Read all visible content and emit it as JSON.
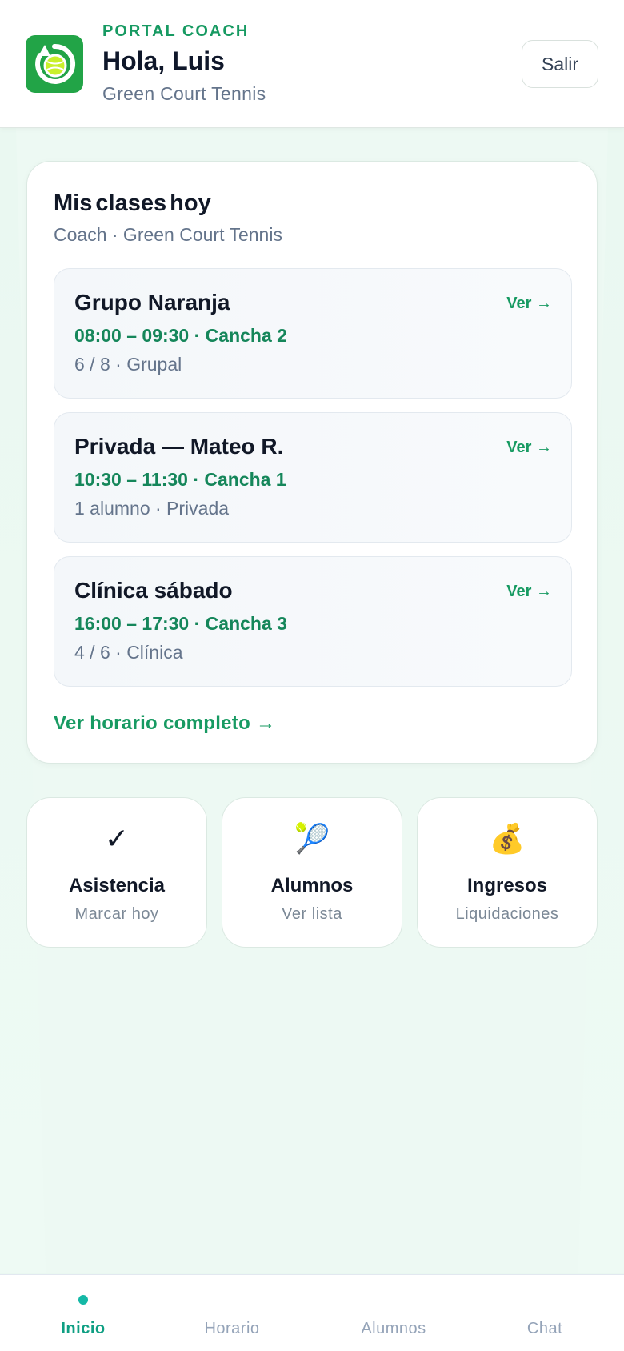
{
  "header": {
    "eyebrow": "PORTAL COACH",
    "greeting": "Hola, Luis",
    "club": "Green Court Tennis",
    "logout_label": "Salir",
    "logo_icon": "tennis-ball-refresh-icon"
  },
  "today": {
    "title": "Mis clases hoy",
    "subtitle": "Coach · Green Court Tennis",
    "classes": [
      {
        "name": "Grupo Naranja",
        "time": "08:00 – 09:30 · Cancha 2",
        "meta": "6 / 8 · Grupal",
        "view": "Ver →"
      },
      {
        "name": "Privada — Mateo R.",
        "time": "10:30 – 11:30 · Cancha 1",
        "meta": "1 alumno · Privada",
        "view": "Ver →"
      },
      {
        "name": "Clínica sábado",
        "time": "16:00 – 17:30 · Cancha 3",
        "meta": "4 / 6 · Clínica",
        "view": "Ver →"
      }
    ],
    "full_schedule_link": "Ver horario completo →"
  },
  "tiles": [
    {
      "icon": "✓",
      "icon_name": "checkmark-icon",
      "title": "Asistencia",
      "subtitle": "Marcar hoy"
    },
    {
      "icon": "🎾",
      "icon_name": "tennis-racket-icon",
      "title": "Alumnos",
      "subtitle": "Ver lista"
    },
    {
      "icon": "💰",
      "icon_name": "money-bag-icon",
      "title": "Ingresos",
      "subtitle": "Liquidaciones"
    }
  ],
  "nav": {
    "items": [
      {
        "label": "Inicio",
        "active": true
      },
      {
        "label": "Horario",
        "active": false
      },
      {
        "label": "Alumnos",
        "active": false
      },
      {
        "label": "Chat",
        "active": false
      }
    ]
  },
  "colors": {
    "brand_green": "#179a62",
    "time_green": "#15865a",
    "logo_bg": "#22a447",
    "page_bg": "#eaf8f1",
    "nav_active": "#0f9f83"
  }
}
